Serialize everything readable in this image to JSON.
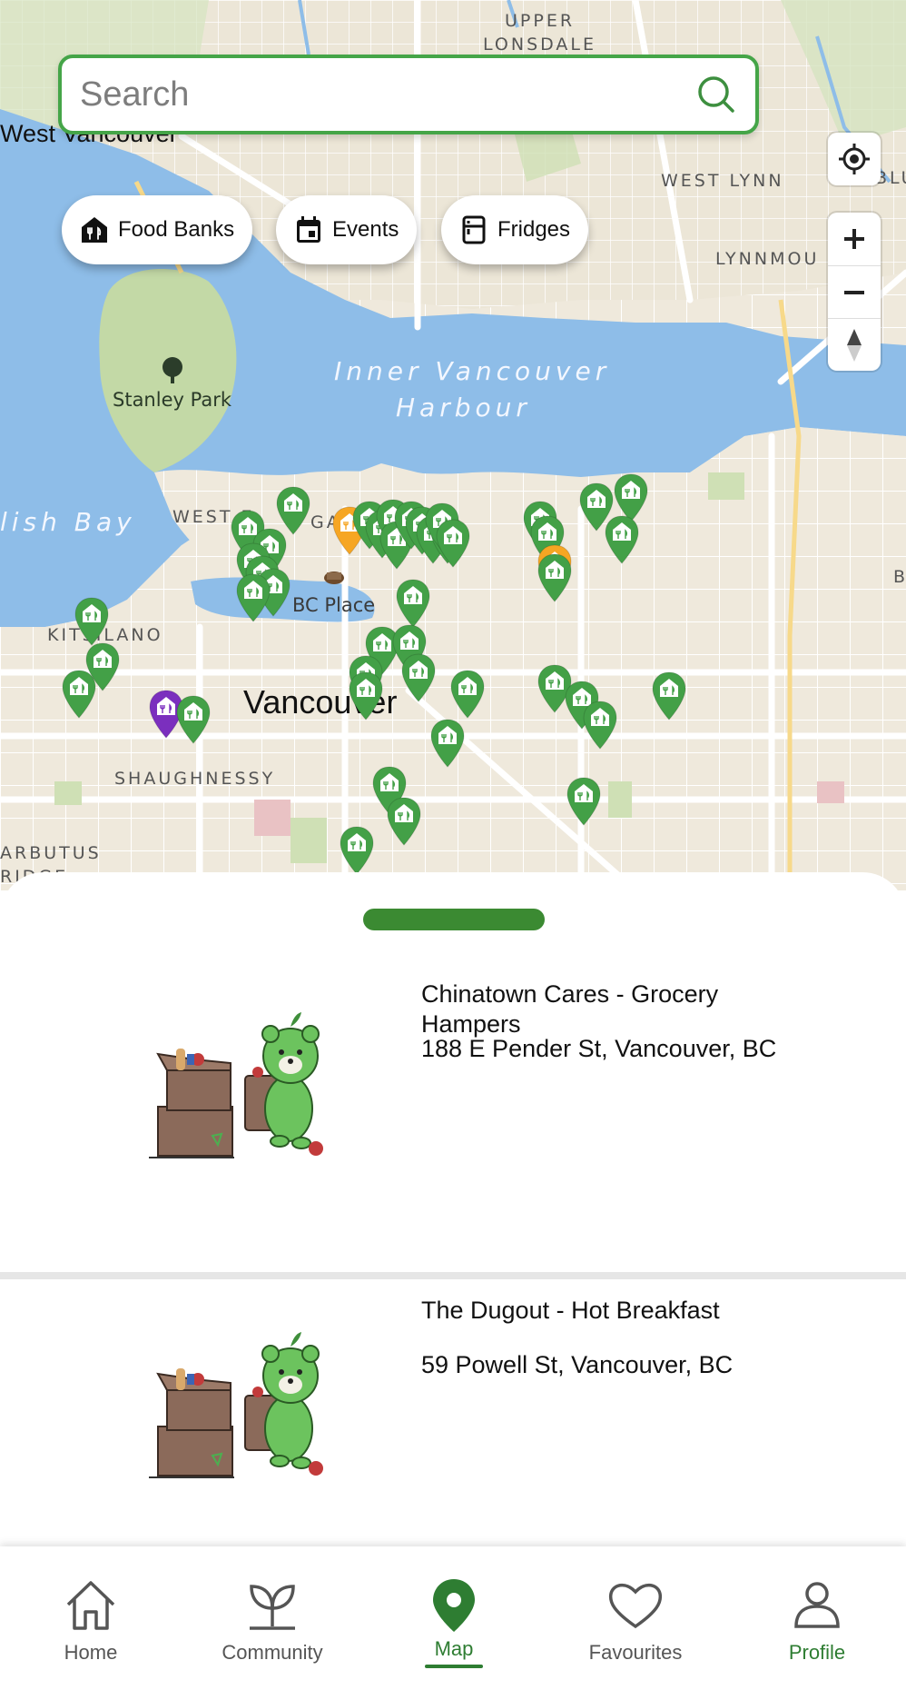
{
  "search": {
    "placeholder": "Search"
  },
  "filters": [
    {
      "label": "Food Banks",
      "icon": "food-bank-icon"
    },
    {
      "label": "Events",
      "icon": "calendar-icon"
    },
    {
      "label": "Fridges",
      "icon": "fridge-icon"
    }
  ],
  "map": {
    "labels": {
      "upper": "UPPER",
      "lonsdale": "LONSDALE",
      "west_vancouver": "West Vancouver",
      "west_lynn": "WEST LYNN",
      "lynnmou": "LYNNMOU",
      "blu": "BLU",
      "inner": "Inner Vancouver",
      "harbour": "Harbour",
      "stanley_park": "Stanley Park",
      "lish_bay": "lish Bay",
      "west_end": "WEST E",
      "ga": "GA",
      "bc_place": "BC Place",
      "kitsilano": "KITSILANO",
      "vancouver": "Vancouver",
      "shaughnessy": "SHAUGHNESSY",
      "arbutus": "ARBUTUS",
      "ridge": "RIDGE",
      "b": "B"
    },
    "colors": {
      "water": "#8ebde8",
      "land": "#efe9dc",
      "park": "#cfe0b5",
      "road": "#ffffff",
      "pin_foodbank": "#43a047",
      "pin_event": "#f6a623",
      "pin_fridge": "#7b2fbe"
    }
  },
  "listings": [
    {
      "title": "Chinatown Cares - Grocery Hampers",
      "address": "188 E Pender St, Vancouver, BC"
    },
    {
      "title": "The Dugout - Hot Breakfast",
      "address": "59 Powell St, Vancouver, BC"
    }
  ],
  "nav": {
    "home": "Home",
    "community": "Community",
    "map": "Map",
    "favourites": "Favourites",
    "profile": "Profile"
  }
}
